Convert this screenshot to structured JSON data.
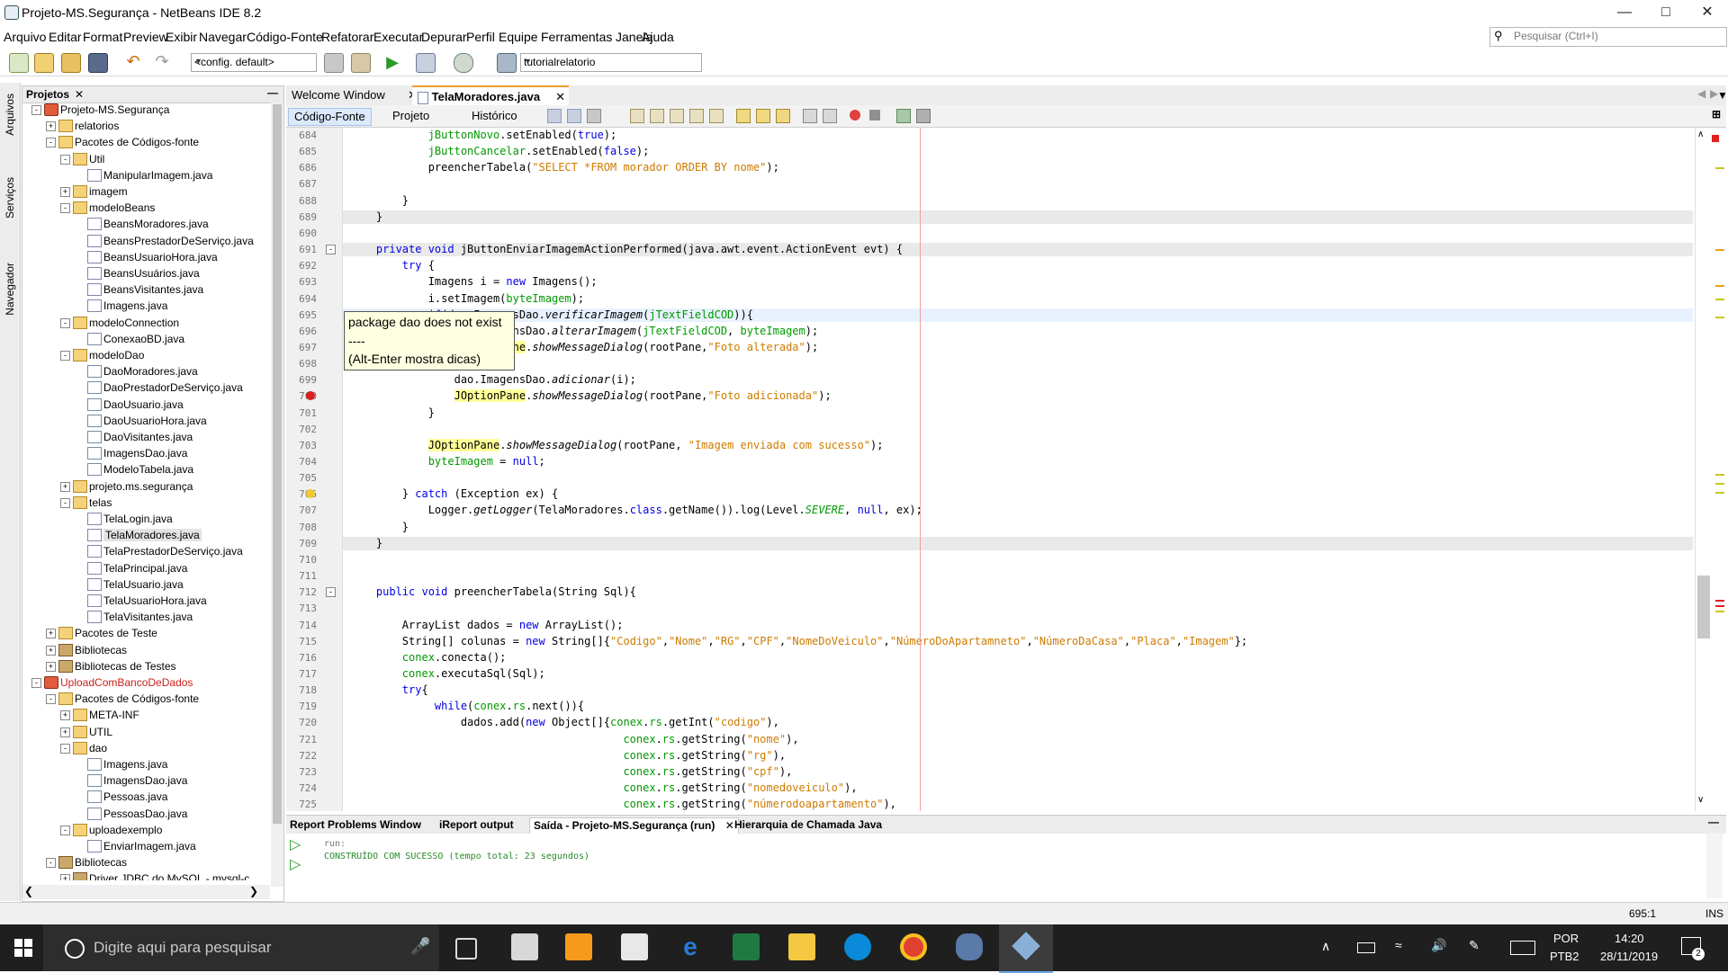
{
  "window": {
    "title": "Projeto-MS.Segurança - NetBeans IDE 8.2",
    "minimize_icon": "minimize-icon",
    "maximize_icon": "maximize-icon",
    "close_icon": "close-icon"
  },
  "menubar": {
    "items": [
      "Arquivo",
      "Editar",
      "Format",
      "Preview",
      "Exibir",
      "Navegar",
      "Código-Fonte",
      "Refatorar",
      "Executar",
      "Depurar",
      "Perfil",
      "Equipe",
      "Ferramentas",
      "Janela",
      "Ajuda"
    ],
    "search_placeholder": "Pesquisar (Ctrl+I)"
  },
  "toolbar": {
    "config": "<config. default>",
    "project": "tutorialrelatorio"
  },
  "left_strip": [
    "Arquivos",
    "Serviços",
    "Navegador"
  ],
  "projects": {
    "tab": "Projetos",
    "tree": [
      {
        "t": "Projeto-MS.Segurança",
        "lvl": 0,
        "ic": "proj",
        "tg": "-"
      },
      {
        "t": "relatorios",
        "lvl": 1,
        "ic": "pkg",
        "tg": "+"
      },
      {
        "t": "Pacotes de Códigos-fonte",
        "lvl": 1,
        "ic": "pkg",
        "tg": "-"
      },
      {
        "t": "Util",
        "lvl": 2,
        "ic": "pkg",
        "tg": "-"
      },
      {
        "t": "ManipularImagem.java",
        "lvl": 3,
        "ic": "file"
      },
      {
        "t": "imagem",
        "lvl": 2,
        "ic": "pkg",
        "tg": "+"
      },
      {
        "t": "modeloBeans",
        "lvl": 2,
        "ic": "pkg",
        "tg": "-"
      },
      {
        "t": "BeansMoradores.java",
        "lvl": 3,
        "ic": "file"
      },
      {
        "t": "BeansPrestadorDeServiço.java",
        "lvl": 3,
        "ic": "file"
      },
      {
        "t": "BeansUsuarioHora.java",
        "lvl": 3,
        "ic": "file"
      },
      {
        "t": "BeansUsuários.java",
        "lvl": 3,
        "ic": "file"
      },
      {
        "t": "BeansVisitantes.java",
        "lvl": 3,
        "ic": "file"
      },
      {
        "t": "Imagens.java",
        "lvl": 3,
        "ic": "file"
      },
      {
        "t": "modeloConnection",
        "lvl": 2,
        "ic": "pkg",
        "tg": "-"
      },
      {
        "t": "ConexaoBD.java",
        "lvl": 3,
        "ic": "file"
      },
      {
        "t": "modeloDao",
        "lvl": 2,
        "ic": "pkg",
        "tg": "-"
      },
      {
        "t": "DaoMoradores.java",
        "lvl": 3,
        "ic": "file"
      },
      {
        "t": "DaoPrestadorDeServiço.java",
        "lvl": 3,
        "ic": "file"
      },
      {
        "t": "DaoUsuario.java",
        "lvl": 3,
        "ic": "file"
      },
      {
        "t": "DaoUsuarioHora.java",
        "lvl": 3,
        "ic": "file"
      },
      {
        "t": "DaoVisitantes.java",
        "lvl": 3,
        "ic": "file"
      },
      {
        "t": "ImagensDao.java",
        "lvl": 3,
        "ic": "file"
      },
      {
        "t": "ModeloTabela.java",
        "lvl": 3,
        "ic": "file"
      },
      {
        "t": "projeto.ms.segurança",
        "lvl": 2,
        "ic": "pkg",
        "tg": "+"
      },
      {
        "t": "telas",
        "lvl": 2,
        "ic": "pkg",
        "tg": "-"
      },
      {
        "t": "TelaLogin.java",
        "lvl": 3,
        "ic": "file"
      },
      {
        "t": "TelaMoradores.java",
        "lvl": 3,
        "ic": "file",
        "sel": true
      },
      {
        "t": "TelaPrestadorDeServiço.java",
        "lvl": 3,
        "ic": "file"
      },
      {
        "t": "TelaPrincipal.java",
        "lvl": 3,
        "ic": "file"
      },
      {
        "t": "TelaUsuario.java",
        "lvl": 3,
        "ic": "file"
      },
      {
        "t": "TelaUsuarioHora.java",
        "lvl": 3,
        "ic": "file"
      },
      {
        "t": "TelaVisitantes.java",
        "lvl": 3,
        "ic": "file"
      },
      {
        "t": "Pacotes de Teste",
        "lvl": 1,
        "ic": "pkg",
        "tg": "+"
      },
      {
        "t": "Bibliotecas",
        "lvl": 1,
        "ic": "lib",
        "tg": "+"
      },
      {
        "t": "Bibliotecas de Testes",
        "lvl": 1,
        "ic": "lib",
        "tg": "+"
      },
      {
        "t": "UploadComBancoDeDados",
        "lvl": 0,
        "ic": "proj",
        "tg": "-",
        "red": true
      },
      {
        "t": "Pacotes de Códigos-fonte",
        "lvl": 1,
        "ic": "pkg",
        "tg": "-"
      },
      {
        "t": "META-INF",
        "lvl": 2,
        "ic": "pkg",
        "tg": "+"
      },
      {
        "t": "UTIL",
        "lvl": 2,
        "ic": "pkg",
        "tg": "+"
      },
      {
        "t": "dao",
        "lvl": 2,
        "ic": "pkg",
        "tg": "-"
      },
      {
        "t": "Imagens.java",
        "lvl": 3,
        "ic": "file"
      },
      {
        "t": "ImagensDao.java",
        "lvl": 3,
        "ic": "file"
      },
      {
        "t": "Pessoas.java",
        "lvl": 3,
        "ic": "file"
      },
      {
        "t": "PessoasDao.java",
        "lvl": 3,
        "ic": "file"
      },
      {
        "t": "uploadexemplo",
        "lvl": 2,
        "ic": "pkg",
        "tg": "-"
      },
      {
        "t": "EnviarImagem.java",
        "lvl": 3,
        "ic": "file"
      },
      {
        "t": "Bibliotecas",
        "lvl": 1,
        "ic": "lib",
        "tg": "-"
      },
      {
        "t": "Driver JDBC do MySQL - mysql-c",
        "lvl": 2,
        "ic": "lib",
        "tg": "+"
      }
    ]
  },
  "editor": {
    "tabs": [
      "Welcome Window",
      "TelaMoradores.java"
    ],
    "subtabs": [
      "Código-Fonte",
      "Projeto",
      "Histórico"
    ],
    "tooltip": [
      "package dao does not exist",
      "----",
      "(Alt-Enter mostra dicas)"
    ],
    "lines": [
      {
        "n": "684",
        "h": "            <span class=\"fd\">jButtonNovo</span>.setEnabled(<span class=\"kw\">true</span>);"
      },
      {
        "n": "685",
        "h": "            <span class=\"fd\">jButtonCancelar</span>.setEnabled(<span class=\"kw\">false</span>);"
      },
      {
        "n": "686",
        "h": "            preencherTabela(<span class=\"st\">\"SELECT *FROM morador ORDER BY nome\"</span>);"
      },
      {
        "n": "687",
        "h": ""
      },
      {
        "n": "688",
        "h": "        }"
      },
      {
        "n": "689",
        "h": "    }",
        "band": true
      },
      {
        "n": "690",
        "h": ""
      },
      {
        "n": "691",
        "h": "    <span class=\"kw\">private void</span> jButtonEnviarImagemActionPerformed(java.awt.event.ActionEvent evt) {",
        "band": true
      },
      {
        "n": "692",
        "h": "        <span class=\"kw\">try</span> {"
      },
      {
        "n": "693",
        "h": "            Imagens i = <span class=\"kw\">new</span> Imagens();"
      },
      {
        "n": "694",
        "h": "            i.setImagem(<span class=\"fd\">byteImagem</span>);"
      },
      {
        "n": "695",
        "h": "            <span class=\"kw\">if</span>(dao.ImagensDao.<span class=\"it\">verificarImagem</span>(<span class=\"fd\">jTextFieldCOD</span>)){",
        "cur": true
      },
      {
        "n": "696",
        "h": "                dao.ImagensDao.<span class=\"it\">alterarImagem</span>(<span class=\"fd\">jTextFieldCOD</span>, <span class=\"fd\">byteImagem</span>);"
      },
      {
        "n": "697",
        "h": "                <span class=\"hl\">JOptionPane</span>.<span class=\"it\">showMessageDialog</span>(rootPane,<span class=\"st\">\"Foto alterada\"</span>);"
      },
      {
        "n": "698",
        "h": "            }<span class=\"kw\">else</span>{"
      },
      {
        "n": "699",
        "h": "                dao.ImagensDao.<span class=\"it\">adicionar</span>(i);"
      },
      {
        "n": "700",
        "h": "                <span class=\"hl\">JOptionPane</span>.<span class=\"it\">showMessageDialog</span>(rootPane,<span class=\"st\">\"Foto adicionada\"</span>);"
      },
      {
        "n": "701",
        "h": "            }"
      },
      {
        "n": "702",
        "h": ""
      },
      {
        "n": "703",
        "h": "            <span class=\"hl\">JOptionPane</span>.<span class=\"it\">showMessageDialog</span>(rootPane, <span class=\"st\">\"Imagem enviada com sucesso\"</span>);"
      },
      {
        "n": "704",
        "h": "            <span class=\"fd\">byteImagem</span> = <span class=\"kw\">null</span>;"
      },
      {
        "n": "705",
        "h": ""
      },
      {
        "n": "706",
        "h": "        } <span class=\"kw\">catch</span> (Exception ex) {"
      },
      {
        "n": "707",
        "h": "            Logger.<span class=\"it\">getLogger</span>(TelaMoradores.<span class=\"kw\">class</span>.getName()).log(Level.<span class=\"fd it\">SEVERE</span>, <span class=\"kw\">null</span>, ex);"
      },
      {
        "n": "708",
        "h": "        }"
      },
      {
        "n": "709",
        "h": "    }",
        "band": true
      },
      {
        "n": "710",
        "h": ""
      },
      {
        "n": "711",
        "h": ""
      },
      {
        "n": "712",
        "h": "    <span class=\"kw\">public void</span> preencherTabela(String Sql){"
      },
      {
        "n": "713",
        "h": ""
      },
      {
        "n": "714",
        "h": "        ArrayList dados = <span class=\"kw\">new</span> ArrayList();"
      },
      {
        "n": "715",
        "h": "        String[] colunas = <span class=\"kw\">new</span> String[]{<span class=\"st\">\"Codigo\"</span>,<span class=\"st\">\"Nome\"</span>,<span class=\"st\">\"RG\"</span>,<span class=\"st\">\"CPF\"</span>,<span class=\"st\">\"NomeDoVeiculo\"</span>,<span class=\"st\">\"NúmeroDoApartamneto\"</span>,<span class=\"st\">\"NúmeroDaCasa\"</span>,<span class=\"st\">\"Placa\"</span>,<span class=\"st\">\"Imagem\"</span>};"
      },
      {
        "n": "716",
        "h": "        <span class=\"fd\">conex</span>.conecta();"
      },
      {
        "n": "717",
        "h": "        <span class=\"fd\">conex</span>.executaSql(Sql);"
      },
      {
        "n": "718",
        "h": "        <span class=\"kw\">try</span>{"
      },
      {
        "n": "719",
        "h": "             <span class=\"kw\">while</span>(<span class=\"fd\">conex</span>.<span class=\"fd\">rs</span>.next()){"
      },
      {
        "n": "720",
        "h": "                 dados.add(<span class=\"kw\">new</span> Object[]{<span class=\"fd\">conex</span>.<span class=\"fd\">rs</span>.getInt(<span class=\"st\">\"codigo\"</span>),"
      },
      {
        "n": "721",
        "h": "                                          <span class=\"fd\">conex</span>.<span class=\"fd\">rs</span>.getString(<span class=\"st\">\"nome\"</span>),"
      },
      {
        "n": "722",
        "h": "                                          <span class=\"fd\">conex</span>.<span class=\"fd\">rs</span>.getString(<span class=\"st\">\"rg\"</span>),"
      },
      {
        "n": "723",
        "h": "                                          <span class=\"fd\">conex</span>.<span class=\"fd\">rs</span>.getString(<span class=\"st\">\"cpf\"</span>),"
      },
      {
        "n": "724",
        "h": "                                          <span class=\"fd\">conex</span>.<span class=\"fd\">rs</span>.getString(<span class=\"st\">\"nomedoveiculo\"</span>),"
      },
      {
        "n": "725",
        "h": "                                          <span class=\"fd\">conex</span>.<span class=\"fd\">rs</span>.getString(<span class=\"st\">\"númerodoapartamento\"</span>),"
      }
    ]
  },
  "output": {
    "tabs": [
      "Report Problems Window",
      "iReport output",
      "Saída - Projeto-MS.Segurança (run)",
      "Hierarquia de Chamada Java"
    ],
    "lines": [
      "run:",
      "CONSTRUÍDO COM SUCESSO (tempo total: 23 segundos)"
    ]
  },
  "status": {
    "position": "695:1",
    "mode": "INS"
  },
  "taskbar": {
    "search_placeholder": "Digite aqui para pesquisar",
    "lang1": "POR",
    "lang2": "PTB2",
    "time": "14:20",
    "date": "28/11/2019",
    "notif": "2"
  }
}
